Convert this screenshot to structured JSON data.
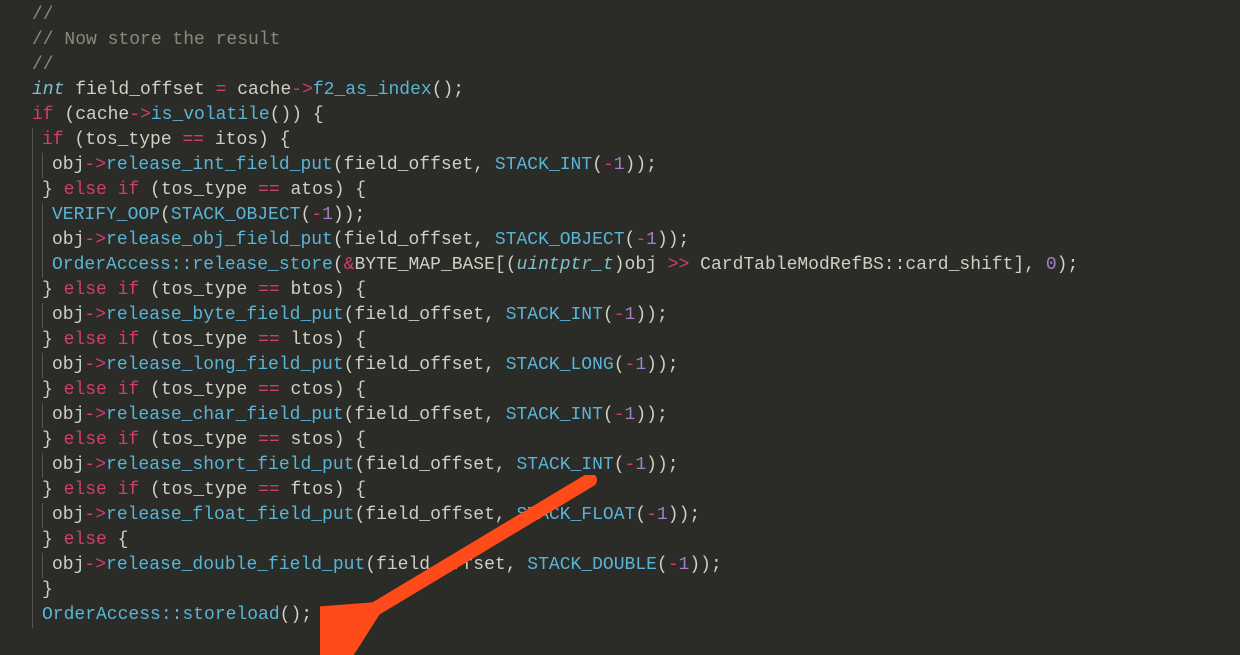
{
  "colors": {
    "bg": "#2b2b28",
    "comment": "#8a8a7a",
    "keyword_flow": "#d33c6e",
    "keyword_type": "#7fc1ca",
    "func": "#59b5d6",
    "const": "#59b5d6",
    "num": "#a57fc4",
    "plain": "#cfcfc2",
    "arrow_annotation": "#ff4a1a"
  },
  "code": {
    "l1": "//",
    "l2": "// Now store the result",
    "l3": "//",
    "l4a": "int",
    "l4b": " field_offset ",
    "l4c": "=",
    "l4d": " cache",
    "l4e": "->",
    "l4f": "f2_as_index",
    "l4g": "();",
    "l5a": "if",
    "l5b": " (cache",
    "l5c": "->",
    "l5d": "is_volatile",
    "l5e": "()) {",
    "l6a": "if",
    "l6b": " (tos_type ",
    "l6c": "==",
    "l6d": " itos) {",
    "l7a": "obj",
    "l7b": "->",
    "l7c": "release_int_field_put",
    "l7d": "(field_offset, ",
    "l7e": "STACK_INT",
    "l7f": "(",
    "l7g": "-",
    "l7h": "1",
    "l7i": "));",
    "l8a": "} ",
    "l8b": "else",
    "l8c": " ",
    "l8d": "if",
    "l8e": " (tos_type ",
    "l8f": "==",
    "l8g": " atos) {",
    "l9a": "VERIFY_OOP",
    "l9b": "(",
    "l9c": "STACK_OBJECT",
    "l9d": "(",
    "l9e": "-",
    "l9f": "1",
    "l9g": "));",
    "l10a": "obj",
    "l10b": "->",
    "l10c": "release_obj_field_put",
    "l10d": "(field_offset, ",
    "l10e": "STACK_OBJECT",
    "l10f": "(",
    "l10g": "-",
    "l10h": "1",
    "l10i": "));",
    "l11a": "OrderAccess::release_store",
    "l11b": "(",
    "l11c": "&",
    "l11d": "BYTE_MAP_BASE[(",
    "l11e": "uintptr_t",
    "l11f": ")obj ",
    "l11g": ">>",
    "l11h": " CardTableModRefBS::card_shift], ",
    "l11i": "0",
    "l11j": ");",
    "l12a": "} ",
    "l12b": "else",
    "l12c": " ",
    "l12d": "if",
    "l12e": " (tos_type ",
    "l12f": "==",
    "l12g": " btos) {",
    "l13a": "obj",
    "l13b": "->",
    "l13c": "release_byte_field_put",
    "l13d": "(field_offset, ",
    "l13e": "STACK_INT",
    "l13f": "(",
    "l13g": "-",
    "l13h": "1",
    "l13i": "));",
    "l14a": "} ",
    "l14b": "else",
    "l14c": " ",
    "l14d": "if",
    "l14e": " (tos_type ",
    "l14f": "==",
    "l14g": " ltos) {",
    "l15a": "obj",
    "l15b": "->",
    "l15c": "release_long_field_put",
    "l15d": "(field_offset, ",
    "l15e": "STACK_LONG",
    "l15f": "(",
    "l15g": "-",
    "l15h": "1",
    "l15i": "));",
    "l16a": "} ",
    "l16b": "else",
    "l16c": " ",
    "l16d": "if",
    "l16e": " (tos_type ",
    "l16f": "==",
    "l16g": " ctos) {",
    "l17a": "obj",
    "l17b": "->",
    "l17c": "release_char_field_put",
    "l17d": "(field_offset, ",
    "l17e": "STACK_INT",
    "l17f": "(",
    "l17g": "-",
    "l17h": "1",
    "l17i": "));",
    "l18a": "} ",
    "l18b": "else",
    "l18c": " ",
    "l18d": "if",
    "l18e": " (tos_type ",
    "l18f": "==",
    "l18g": " stos) {",
    "l19a": "obj",
    "l19b": "->",
    "l19c": "release_short_field_put",
    "l19d": "(field_offset, ",
    "l19e": "STACK_INT",
    "l19f": "(",
    "l19g": "-",
    "l19h": "1",
    "l19i": "));",
    "l20a": "} ",
    "l20b": "else",
    "l20c": " ",
    "l20d": "if",
    "l20e": " (tos_type ",
    "l20f": "==",
    "l20g": " ftos) {",
    "l21a": "obj",
    "l21b": "->",
    "l21c": "release_float_field_put",
    "l21d": "(field_offset, ",
    "l21e": "STACK_FLOAT",
    "l21f": "(",
    "l21g": "-",
    "l21h": "1",
    "l21i": "));",
    "l22a": "} ",
    "l22b": "else",
    "l22c": " {",
    "l23a": "obj",
    "l23b": "->",
    "l23c": "release_double_field_put",
    "l23d": "(field_offset, ",
    "l23e": "STACK_DOUBLE",
    "l23f": "(",
    "l23g": "-",
    "l23h": "1",
    "l23i": "));",
    "l24": "}",
    "l25a": "OrderAccess::storeload",
    "l25b": "();"
  },
  "annotation": {
    "type": "arrow",
    "color": "#ff4a1a",
    "direction": "down-left",
    "target": "OrderAccess::storeload"
  }
}
